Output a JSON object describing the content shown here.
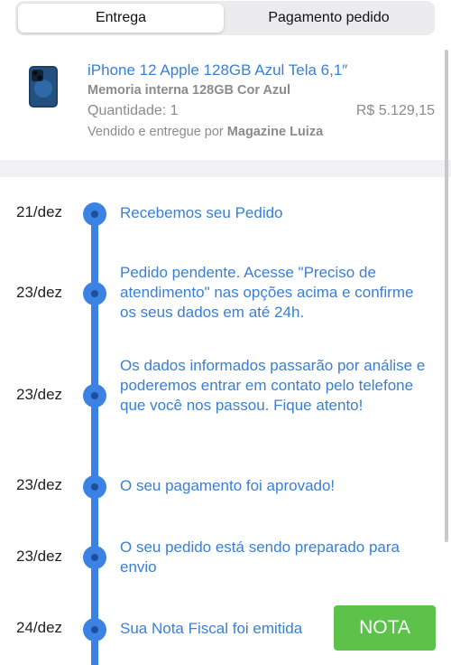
{
  "tabs": [
    {
      "label": "Entrega",
      "active": true
    },
    {
      "label": "Pagamento pedido",
      "active": false
    }
  ],
  "product": {
    "title": "iPhone 12 Apple 128GB Azul Tela 6,1″",
    "subtitle": "Memoria interna 128GB Cor Azul",
    "quantity": "Quantidade: 1",
    "price": "R$ 5.129,15",
    "seller_prefix": "Vendido e entregue por",
    "seller_name": "Magazine Luiza"
  },
  "timeline": [
    {
      "date": "21/dez",
      "text": "Recebemos seu Pedido"
    },
    {
      "date": "23/dez",
      "text": "Pedido pendente. Acesse \"Preciso de atendimento\" nas opções acima e confirme os seus dados em até 24h."
    },
    {
      "date": "23/dez",
      "text": "Os dados informados passarão por análise e poderemos entrar em contato pelo telefone que você nos passou. Fique atento!"
    },
    {
      "date": "23/dez",
      "text": "O seu pagamento foi aprovado!"
    },
    {
      "date": "23/dez",
      "text": "O seu pedido está sendo preparado para envio"
    },
    {
      "date": "24/dez",
      "text": "Sua Nota Fiscal foi emitida"
    }
  ],
  "nota_button": "NOTA",
  "colors": {
    "accent_blue": "#3b82e5",
    "link_blue": "#3a7fd2",
    "button_green": "#5cc24a",
    "muted_gray": "#8b8b8b"
  }
}
